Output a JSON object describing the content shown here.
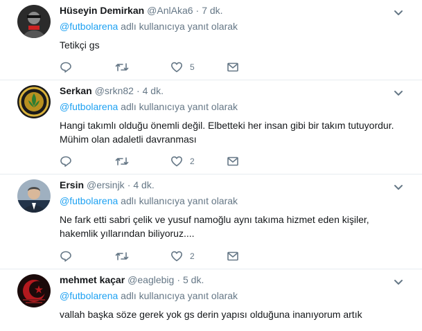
{
  "tweets": [
    {
      "name": "Hüseyin Demirkan",
      "handle": "@AnlAka6",
      "separator": "·",
      "time": "7 dk.",
      "reply_prefix": "@futbolarena",
      "reply_suffix": " adlı kullanıcıya yanıt olarak",
      "text": "Tetikçi gs",
      "reply_count": "",
      "retweet_count": "",
      "like_count": "5"
    },
    {
      "name": "Serkan",
      "handle": "@srkn82",
      "separator": "·",
      "time": "4 dk.",
      "reply_prefix": "@futbolarena",
      "reply_suffix": " adlı kullanıcıya yanıt olarak",
      "text": "Hangi takımlı olduğu önemli değil. Elbetteki her insan gibi bir takım tutuyordur. Mühim olan adaletli davranması",
      "reply_count": "",
      "retweet_count": "",
      "like_count": "2"
    },
    {
      "name": "Ersin",
      "handle": "@ersinjk",
      "separator": "·",
      "time": "4 dk.",
      "reply_prefix": "@futbolarena",
      "reply_suffix": " adlı kullanıcıya yanıt olarak",
      "text": "Ne fark etti sabri çelik ve yusuf namoğlu aynı takıma hizmet eden kişiler, hakemlik yıllarından biliyoruz....",
      "reply_count": "",
      "retweet_count": "",
      "like_count": "2"
    },
    {
      "name": "mehmet kaçar",
      "handle": "@eaglebig",
      "separator": "·",
      "time": "5 dk.",
      "reply_prefix": "@futbolarena",
      "reply_suffix": " adlı kullanıcıya yanıt olarak",
      "text": "vallah başka söze gerek yok gs derin yapısı olduğuna inanıyorum artık",
      "reply_count": "",
      "retweet_count": "",
      "like_count": ""
    }
  ],
  "icons": {
    "reply": "reply-icon",
    "retweet": "retweet-icon",
    "like": "heart-icon",
    "dm": "direct-message-icon",
    "menu": "chevron-down-icon"
  },
  "colors": {
    "text": "#14171a",
    "muted": "#657786",
    "link": "#1da1f2",
    "border": "#e6ecf0"
  }
}
